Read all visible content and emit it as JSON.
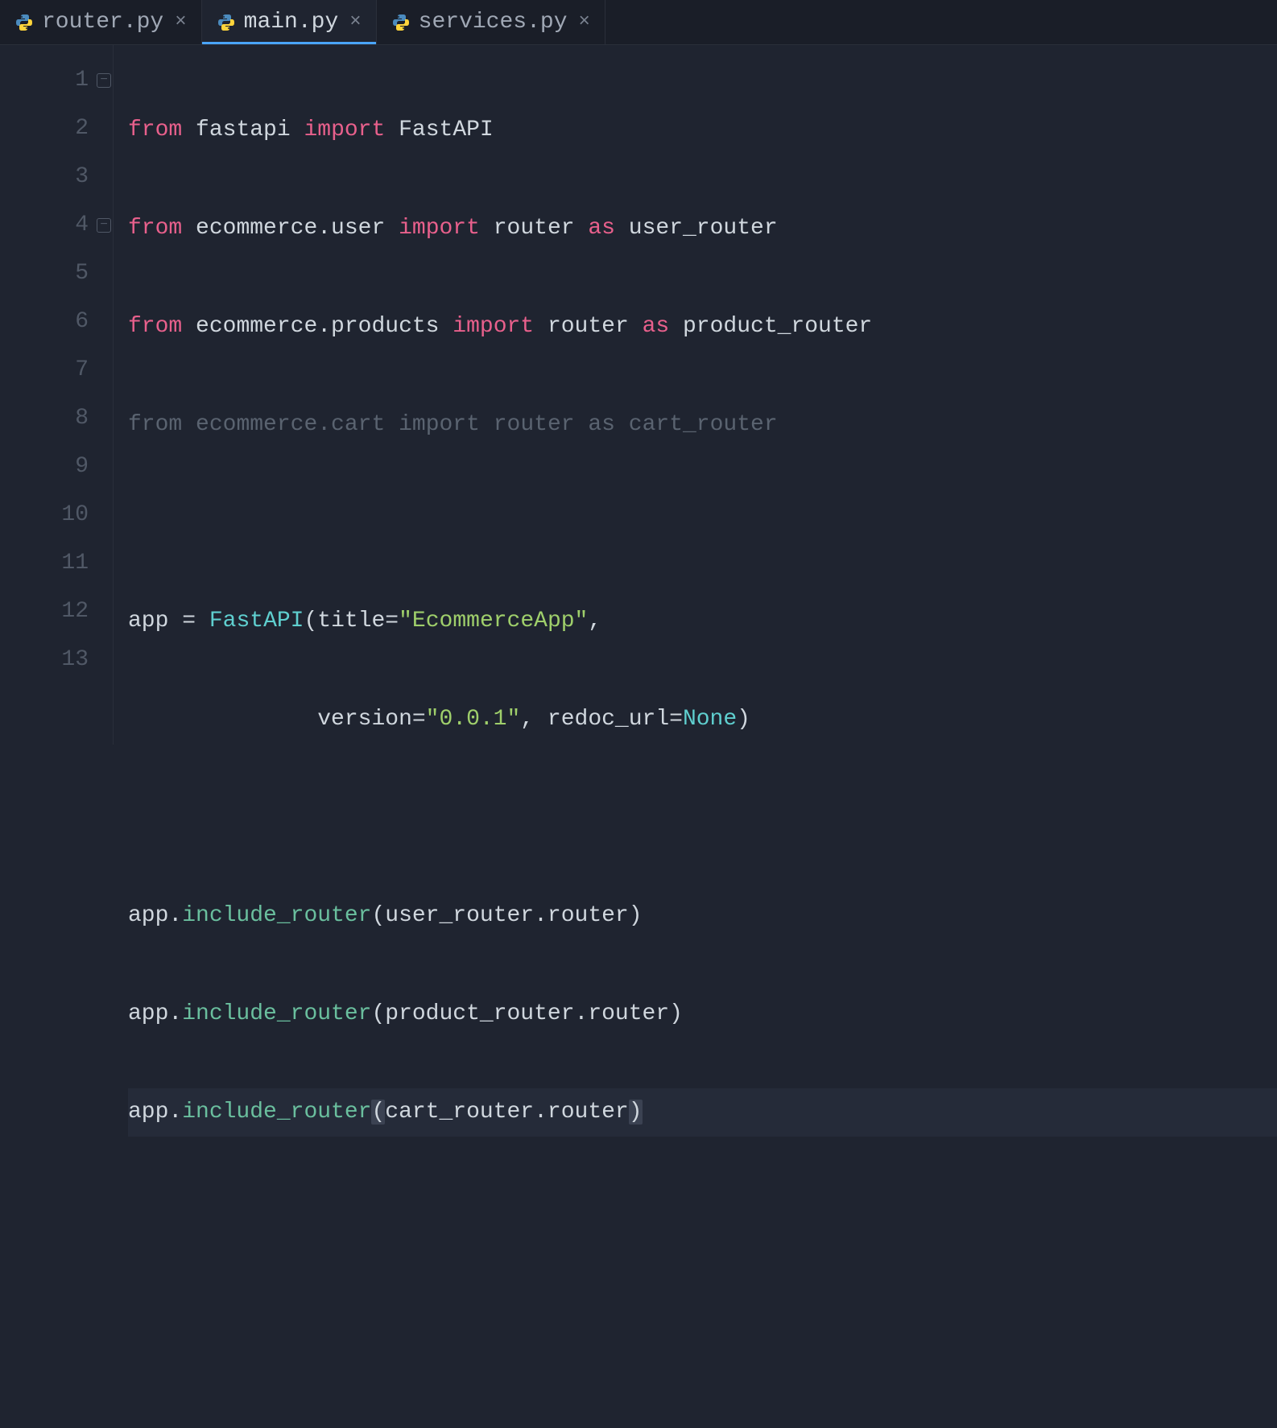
{
  "tabs": [
    {
      "label": "router.py",
      "active": false
    },
    {
      "label": "main.py",
      "active": true
    },
    {
      "label": "services.py",
      "active": false
    }
  ],
  "gutter": {
    "lines": [
      "1",
      "2",
      "3",
      "4",
      "5",
      "6",
      "7",
      "8",
      "9",
      "10",
      "11",
      "12",
      "13"
    ],
    "fold_at": [
      1,
      4
    ]
  },
  "code": {
    "l1": {
      "from": "from",
      "mod": "fastapi",
      "import": "import",
      "name": "FastAPI"
    },
    "l2": {
      "from": "from",
      "mod": "ecommerce.user",
      "import": "import",
      "name": "router",
      "as": "as",
      "alias": "user_router"
    },
    "l3": {
      "from": "from",
      "mod": "ecommerce.products",
      "import": "import",
      "name": "router",
      "as": "as",
      "alias": "product_router"
    },
    "l4": {
      "from": "from",
      "mod": "ecommerce.cart",
      "import": "import",
      "name": "router",
      "as": "as",
      "alias": "cart_router"
    },
    "l6": {
      "lhs": "app",
      "eq": "=",
      "cls": "FastAPI",
      "p1": "title=",
      "s1": "\"EcommerceApp\"",
      "comma": ","
    },
    "l7": {
      "pad": "              ",
      "p2": "version=",
      "s2": "\"0.0.1\"",
      "comma": ",",
      "p3": "redoc_url=",
      "none": "None",
      "close": ")"
    },
    "l9": {
      "obj": "app.",
      "fn": "include_router",
      "arg": "(user_router.router)"
    },
    "l10": {
      "obj": "app.",
      "fn": "include_router",
      "arg": "(product_router.router)"
    },
    "l11": {
      "obj": "app.",
      "fn": "include_router",
      "open": "(",
      "arg": "cart_router.router",
      "close": ")"
    }
  }
}
